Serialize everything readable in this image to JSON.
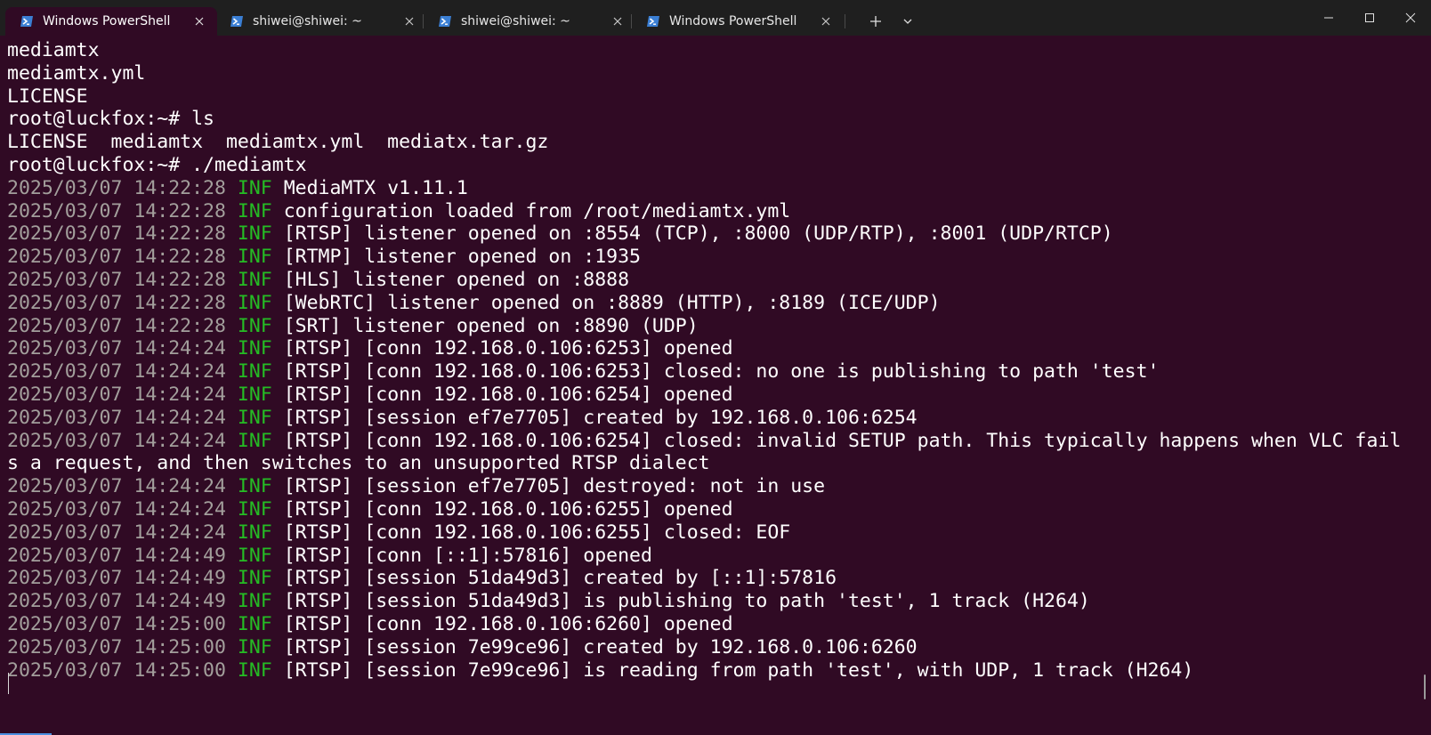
{
  "tabs": [
    {
      "label": "Windows PowerShell",
      "active": true,
      "icon": "powershell-icon"
    },
    {
      "label": "shiwei@shiwei: ~",
      "active": false,
      "icon": "powershell-icon"
    },
    {
      "label": "shiwei@shiwei: ~",
      "active": false,
      "icon": "powershell-icon"
    },
    {
      "label": "Windows PowerShell",
      "active": false,
      "icon": "powershell-icon"
    }
  ],
  "toolbar_icons": {
    "new_tab": "plus-icon",
    "dropdown": "chevron-down-icon",
    "minimize": "minimize-icon",
    "maximize": "maximize-icon",
    "close": "close-icon"
  },
  "colors": {
    "terminal_bg": "#300a24",
    "tabbar_bg": "#1f1f1f",
    "timestamp": "#a39f9c",
    "level_info": "#25bc24",
    "text": "#ffffff"
  },
  "terminal": {
    "lines": [
      {
        "text": "mediamtx"
      },
      {
        "text": "mediamtx.yml"
      },
      {
        "text": "LICENSE"
      },
      {
        "text": "root@luckfox:~# ls"
      },
      {
        "text": "LICENSE  mediamtx  mediamtx.yml  mediatx.tar.gz"
      },
      {
        "text": "root@luckfox:~# ./mediamtx"
      },
      {
        "ts": "2025/03/07 14:22:28",
        "lvl": "INF",
        "msg": "MediaMTX v1.11.1"
      },
      {
        "ts": "2025/03/07 14:22:28",
        "lvl": "INF",
        "msg": "configuration loaded from /root/mediamtx.yml"
      },
      {
        "ts": "2025/03/07 14:22:28",
        "lvl": "INF",
        "msg": "[RTSP] listener opened on :8554 (TCP), :8000 (UDP/RTP), :8001 (UDP/RTCP)"
      },
      {
        "ts": "2025/03/07 14:22:28",
        "lvl": "INF",
        "msg": "[RTMP] listener opened on :1935"
      },
      {
        "ts": "2025/03/07 14:22:28",
        "lvl": "INF",
        "msg": "[HLS] listener opened on :8888"
      },
      {
        "ts": "2025/03/07 14:22:28",
        "lvl": "INF",
        "msg": "[WebRTC] listener opened on :8889 (HTTP), :8189 (ICE/UDP)"
      },
      {
        "ts": "2025/03/07 14:22:28",
        "lvl": "INF",
        "msg": "[SRT] listener opened on :8890 (UDP)"
      },
      {
        "ts": "2025/03/07 14:24:24",
        "lvl": "INF",
        "msg": "[RTSP] [conn 192.168.0.106:6253] opened"
      },
      {
        "ts": "2025/03/07 14:24:24",
        "lvl": "INF",
        "msg": "[RTSP] [conn 192.168.0.106:6253] closed: no one is publishing to path 'test'"
      },
      {
        "ts": "2025/03/07 14:24:24",
        "lvl": "INF",
        "msg": "[RTSP] [conn 192.168.0.106:6254] opened"
      },
      {
        "ts": "2025/03/07 14:24:24",
        "lvl": "INF",
        "msg": "[RTSP] [session ef7e7705] created by 192.168.0.106:6254"
      },
      {
        "ts": "2025/03/07 14:24:24",
        "lvl": "INF",
        "msg": "[RTSP] [conn 192.168.0.106:6254] closed: invalid SETUP path. This typically happens when VLC fail"
      },
      {
        "text": "s a request, and then switches to an unsupported RTSP dialect"
      },
      {
        "ts": "2025/03/07 14:24:24",
        "lvl": "INF",
        "msg": "[RTSP] [session ef7e7705] destroyed: not in use"
      },
      {
        "ts": "2025/03/07 14:24:24",
        "lvl": "INF",
        "msg": "[RTSP] [conn 192.168.0.106:6255] opened"
      },
      {
        "ts": "2025/03/07 14:24:24",
        "lvl": "INF",
        "msg": "[RTSP] [conn 192.168.0.106:6255] closed: EOF"
      },
      {
        "ts": "2025/03/07 14:24:49",
        "lvl": "INF",
        "msg": "[RTSP] [conn [::1]:57816] opened"
      },
      {
        "ts": "2025/03/07 14:24:49",
        "lvl": "INF",
        "msg": "[RTSP] [session 51da49d3] created by [::1]:57816"
      },
      {
        "ts": "2025/03/07 14:24:49",
        "lvl": "INF",
        "msg": "[RTSP] [session 51da49d3] is publishing to path 'test', 1 track (H264)"
      },
      {
        "ts": "2025/03/07 14:25:00",
        "lvl": "INF",
        "msg": "[RTSP] [conn 192.168.0.106:6260] opened"
      },
      {
        "ts": "2025/03/07 14:25:00",
        "lvl": "INF",
        "msg": "[RTSP] [session 7e99ce96] created by 192.168.0.106:6260"
      },
      {
        "ts": "2025/03/07 14:25:00",
        "lvl": "INF",
        "msg": "[RTSP] [session 7e99ce96] is reading from path 'test', with UDP, 1 track (H264)"
      }
    ]
  }
}
